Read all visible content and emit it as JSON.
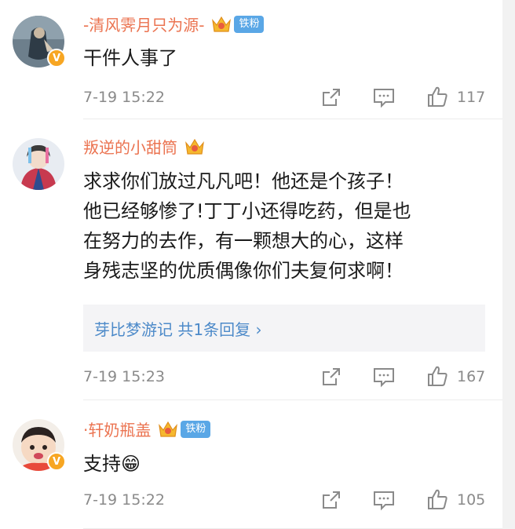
{
  "comments": [
    {
      "name": "-清风霁月只为源-",
      "fan_badge": "铁粉",
      "text_lines": [
        "干件人事了"
      ],
      "time": "7-19 15:22",
      "likes": "117",
      "verified": "V"
    },
    {
      "name": "叛逆的小甜筒",
      "text_lines": [
        "求求你们放过凡凡吧！他还是个孩子！",
        "他已经够惨了!丁丁小还得吃药，但是也",
        "在努力的去作，有一颗想大的心，这样",
        "身残志坚的优质偶像你们夫复何求啊！"
      ],
      "reply_preview": "芽比梦游记  共1条回复  ›",
      "time": "7-19 15:23",
      "likes": "167"
    },
    {
      "name": "·轩奶瓶盖",
      "fan_badge": "铁粉",
      "text_lines": [
        "支持😁"
      ],
      "time": "7-19 15:22",
      "likes": "105",
      "verified": "V"
    }
  ],
  "colors": {
    "username": "#eb7350",
    "reply_link": "#4d8ac9",
    "meta_gray": "#8a8a8a",
    "fan_badge_bg": "#5aa7e6",
    "verified_badge": "#f7a623"
  },
  "icons": [
    "crown-badge-icon",
    "share-icon",
    "comment-icon",
    "thumbs-up-icon"
  ]
}
